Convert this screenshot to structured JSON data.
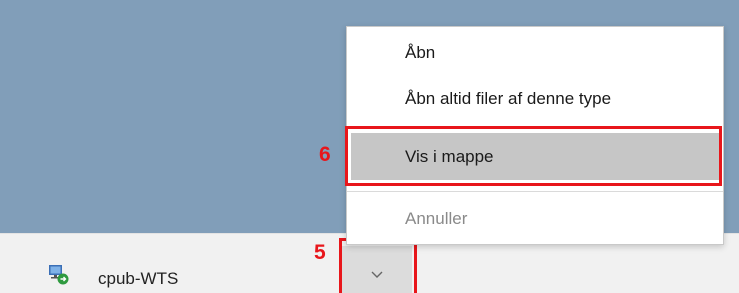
{
  "context_menu": {
    "items": [
      {
        "label": "Åbn"
      },
      {
        "label": "Åbn altid filer af denne type"
      },
      {
        "label": "Vis i mappe"
      },
      {
        "label": "Annuller"
      }
    ]
  },
  "download_bar": {
    "file_name": "cpub-WTS",
    "file_icon": "remote-desktop-file-icon",
    "menu_button_icon": "chevron-down-icon"
  },
  "annotations": {
    "step_5": "5",
    "step_6": "6",
    "highlight_color": "#e8161b"
  },
  "colors": {
    "background_blue": "#819eb9",
    "selected_item": "#c6c6c6",
    "download_bar": "#f1f1f1"
  }
}
